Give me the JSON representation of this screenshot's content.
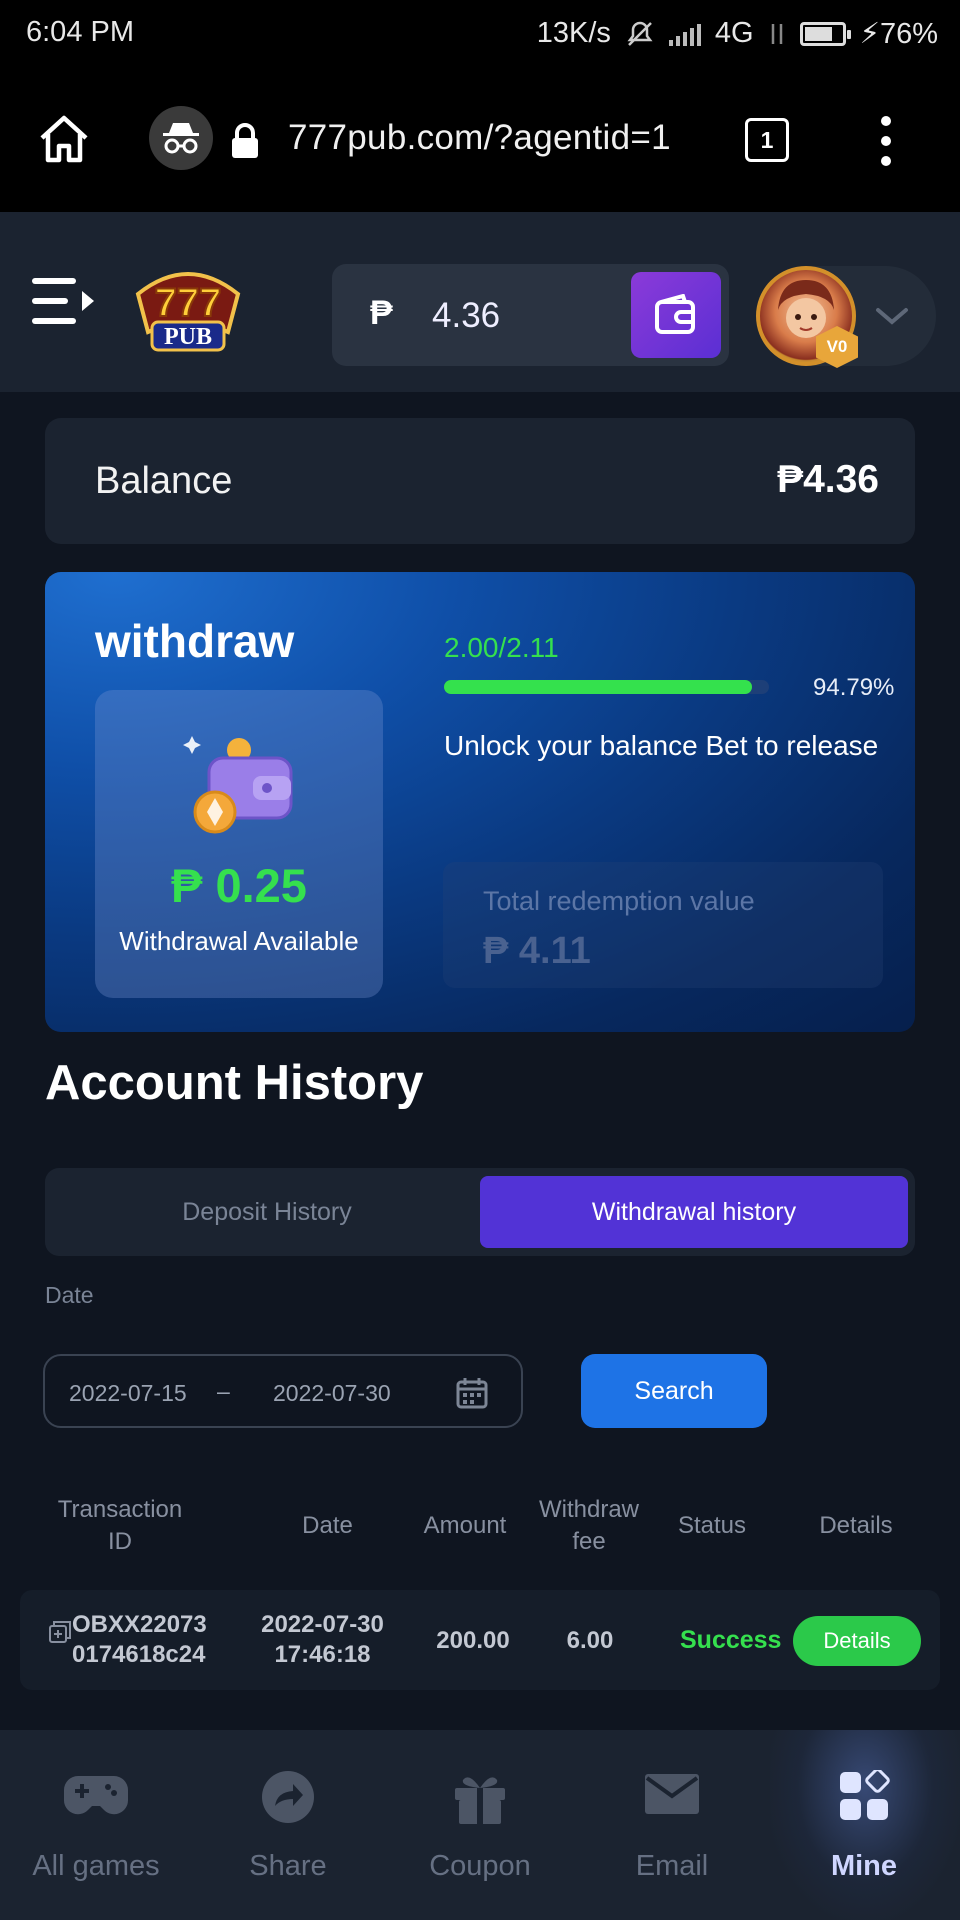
{
  "status_bar": {
    "time": "6:04 PM",
    "net_speed": "13K/s",
    "network": "4G",
    "battery_pct": "76%",
    "battery_level": 0.76
  },
  "browser": {
    "url": "777pub.com/?agentid=1",
    "tab_count": "1"
  },
  "header": {
    "currency_symbol": "₱",
    "balance": "4.36",
    "vip_level": "V0"
  },
  "balance_card": {
    "label": "Balance",
    "value": "₱4.36"
  },
  "withdraw_card": {
    "title": "withdraw",
    "available_amount": "₱ 0.25",
    "available_label": "Withdrawal Available",
    "progress_text": "2.00/2.11",
    "progress_pct_text": "94.79%",
    "progress_fraction": 0.9479,
    "unlock_text": "Unlock your balance Bet to release",
    "redemption_label": "Total redemption value",
    "redemption_value": "₱ 4.11"
  },
  "history": {
    "title": "Account History",
    "tabs": [
      "Deposit History",
      "Withdrawal history"
    ],
    "active_tab": 1,
    "date_label": "Date",
    "date_from": "2022-07-15",
    "date_sep": "–",
    "date_to": "2022-07-30",
    "search_label": "Search",
    "columns": [
      "Transaction ID",
      "Date",
      "Amount",
      "Withdraw fee",
      "Status",
      "Details"
    ],
    "columns_split": {
      "txid_l1": "Transaction",
      "txid_l2": "ID",
      "date": "Date",
      "amount": "Amount",
      "fee_l1": "Withdraw",
      "fee_l2": "fee",
      "status": "Status",
      "details": "Details"
    },
    "rows": [
      {
        "txid_l1": "OBXX22073",
        "txid_l2": "0174618c24",
        "date_l1": "2022-07-30",
        "date_l2": "17:46:18",
        "amount": "200.00",
        "fee": "6.00",
        "status": "Success",
        "details_label": "Details"
      }
    ]
  },
  "bottom_nav": {
    "items": [
      "All games",
      "Share",
      "Coupon",
      "Email",
      "Mine"
    ],
    "active": 4
  },
  "colors": {
    "accent_green": "#35e04e",
    "accent_purple": "#5233d6",
    "accent_blue": "#1e73e6",
    "background": "#0f1520",
    "panel": "#1b2330"
  }
}
